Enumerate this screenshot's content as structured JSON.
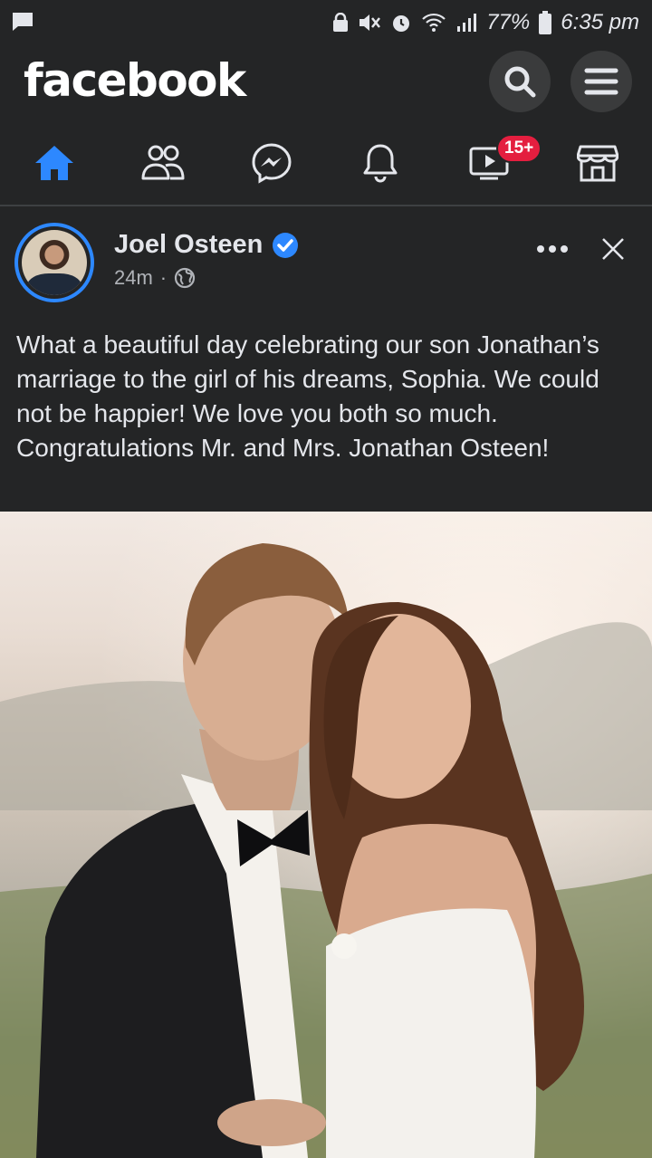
{
  "status_bar": {
    "battery": "77%",
    "time": "6:35 pm"
  },
  "header": {
    "logo": "facebook"
  },
  "nav": {
    "tabs": [
      {
        "name": "home-icon",
        "active": true
      },
      {
        "name": "friends-icon",
        "active": false
      },
      {
        "name": "messenger-icon",
        "active": false
      },
      {
        "name": "notifications-icon",
        "active": false
      },
      {
        "name": "watch-icon",
        "active": false,
        "badge": "15+"
      },
      {
        "name": "marketplace-icon",
        "active": false
      }
    ]
  },
  "post": {
    "author": "Joel Osteen",
    "verified": true,
    "time": "24m",
    "privacy_icon": "globe-icon",
    "text": "What a beautiful day celebrating our son Jonathan’s marriage to the girl of his dreams, Sophia. We could not be happier! We love you both so much. Congratulations Mr. and Mrs. Jonathan Osteen!"
  },
  "colors": {
    "background": "#242526",
    "accent": "#2d88ff",
    "badge": "#e41e3f"
  }
}
